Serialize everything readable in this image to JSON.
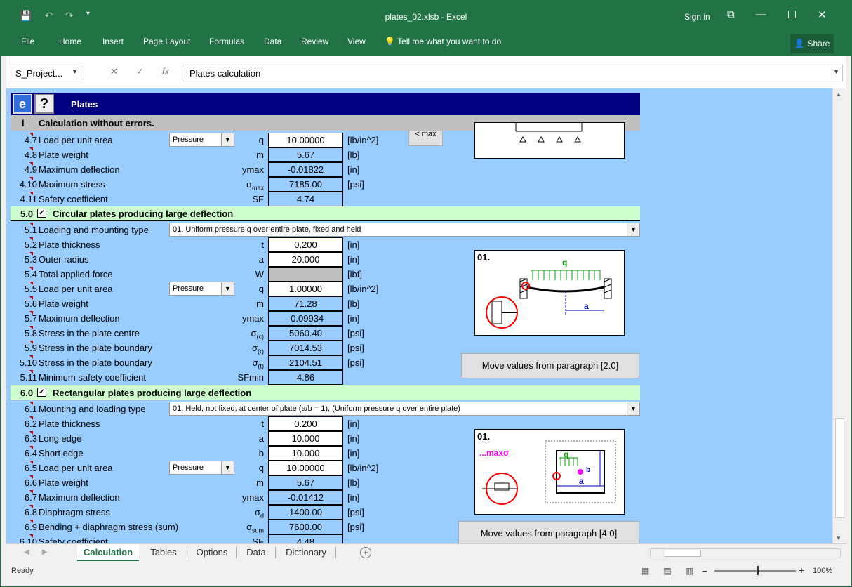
{
  "window": {
    "title": "plates_02.xlsb - Excel",
    "signin": "Sign in"
  },
  "ribbon": {
    "tabs": [
      "File",
      "Home",
      "Insert",
      "Page Layout",
      "Formulas",
      "Data",
      "Review",
      "View"
    ],
    "tell_me": "Tell me what you want to do",
    "share": "Share"
  },
  "formula_bar": {
    "name_box": "S_Project...",
    "content": "Plates calculation"
  },
  "sheet": {
    "header_title": "Plates",
    "status_icon": "i",
    "status_text": "Calculation without errors.",
    "max_button": "< max",
    "sec4_rows": [
      {
        "num": "4.7",
        "label": "Load per unit area",
        "sym": "q",
        "value": "10.00000",
        "unit": "[lb/in^2]",
        "dropdown": "Pressure"
      },
      {
        "num": "4.8",
        "label": "Plate weight",
        "sym": "m",
        "value": "5.67",
        "unit": "[lb]"
      },
      {
        "num": "4.9",
        "label": "Maximum deflection",
        "sym": "ymax",
        "value": "-0.01822",
        "unit": "[in]"
      },
      {
        "num": "4.10",
        "label": "Maximum stress",
        "sym": "σ",
        "sym_sub": "max",
        "value": "7185.00",
        "unit": "[psi]"
      },
      {
        "num": "4.11",
        "label": "Safety coefficient",
        "sym": "SF",
        "value": "4.74",
        "unit": ""
      }
    ],
    "sec5": {
      "num": "5.0",
      "check": "✓",
      "title": "Circular plates producing large deflection",
      "dropdown_row": {
        "num": "5.1",
        "label": "Loading and mounting type",
        "value": "01. Uniform pressure q over entire plate, fixed and held"
      },
      "rows": [
        {
          "num": "5.2",
          "label": "Plate thickness",
          "sym": "t",
          "value": "0.200",
          "unit": "[in]"
        },
        {
          "num": "5.3",
          "label": "Outer radius",
          "sym": "a",
          "value": "20.000",
          "unit": "[in]"
        },
        {
          "num": "5.4",
          "label": "Total applied force",
          "sym": "W",
          "value": "",
          "unit": "[lbf]"
        },
        {
          "num": "5.5",
          "label": "Load per unit area",
          "sym": "q",
          "value": "1.00000",
          "unit": "[lb/in^2]",
          "dropdown": "Pressure"
        },
        {
          "num": "5.6",
          "label": "Plate weight",
          "sym": "m",
          "value": "71.28",
          "unit": "[lb]"
        },
        {
          "num": "5.7",
          "label": "Maximum deflection",
          "sym": "ymax",
          "value": "-0.09934",
          "unit": "[in]"
        },
        {
          "num": "5.8",
          "label": "Stress in the plate centre",
          "sym": "σ",
          "sym_sub": "(c)",
          "value": "5060.40",
          "unit": "[psi]"
        },
        {
          "num": "5.9",
          "label": "Stress in the plate boundary",
          "sym": "σ",
          "sym_sub": "(r)",
          "value": "7014.53",
          "unit": "[psi]"
        },
        {
          "num": "5.10",
          "label": "Stress in the plate boundary",
          "sym": "σ",
          "sym_sub": "(t)",
          "value": "2104.51",
          "unit": "[psi]"
        },
        {
          "num": "5.11",
          "label": "Minimum safety coefficient",
          "sym": "SFmin",
          "value": "4.86",
          "unit": ""
        }
      ],
      "diagram_label": "01.",
      "diagram_q": "q",
      "diagram_a": "a",
      "move_button": "Move values from paragraph [2.0]"
    },
    "sec6": {
      "num": "6.0",
      "check": "✓",
      "title": "Rectangular plates producing large deflection",
      "dropdown_row": {
        "num": "6.1",
        "label": "Mounting and loading type",
        "value": "01. Held, not fixed, at center of plate  (a/b = 1), (Uniform pressure q over entire plate)"
      },
      "rows": [
        {
          "num": "6.2",
          "label": "Plate thickness",
          "sym": "t",
          "value": "0.200",
          "unit": "[in]"
        },
        {
          "num": "6.3",
          "label": "Long edge",
          "sym": "a",
          "value": "10.000",
          "unit": "[in]"
        },
        {
          "num": "6.4",
          "label": "Short edge",
          "sym": "b",
          "value": "10.000",
          "unit": "[in]"
        },
        {
          "num": "6.5",
          "label": "Load per unit area",
          "sym": "q",
          "value": "10.00000",
          "unit": "[lb/in^2]",
          "dropdown": "Pressure"
        },
        {
          "num": "6.6",
          "label": "Plate weight",
          "sym": "m",
          "value": "5.67",
          "unit": "[lb]"
        },
        {
          "num": "6.7",
          "label": "Maximum deflection",
          "sym": "ymax",
          "value": "-0.01412",
          "unit": "[in]"
        },
        {
          "num": "6.8",
          "label": "Diaphragm stress",
          "sym": "σ",
          "sym_sub": "d",
          "value": "1400.00",
          "unit": "[psi]"
        },
        {
          "num": "6.9",
          "label": "Bending + diaphragm stress (sum)",
          "sym": "σ",
          "sym_sub": "sum",
          "value": "7600.00",
          "unit": "[psi]"
        },
        {
          "num": "6.10",
          "label": "Safety coefficient",
          "sym": "SF",
          "value": "4.48",
          "unit": ""
        }
      ],
      "diagram_label": "01.",
      "diagram_legend": "...maxσ",
      "diagram_q": "q",
      "diagram_a": "a",
      "diagram_b": "b",
      "move_button": "Move values from paragraph [4.0]"
    }
  },
  "sheet_tabs": [
    "Calculation",
    "Tables",
    "Options",
    "Data",
    "Dictionary"
  ],
  "active_tab": "Calculation",
  "status": {
    "ready": "Ready",
    "zoom": "100%"
  },
  "colors": {
    "excel_green": "#217346",
    "sheet_bg": "#99ccff",
    "header_navy": "#000080",
    "section_green": "#ccffcc"
  }
}
